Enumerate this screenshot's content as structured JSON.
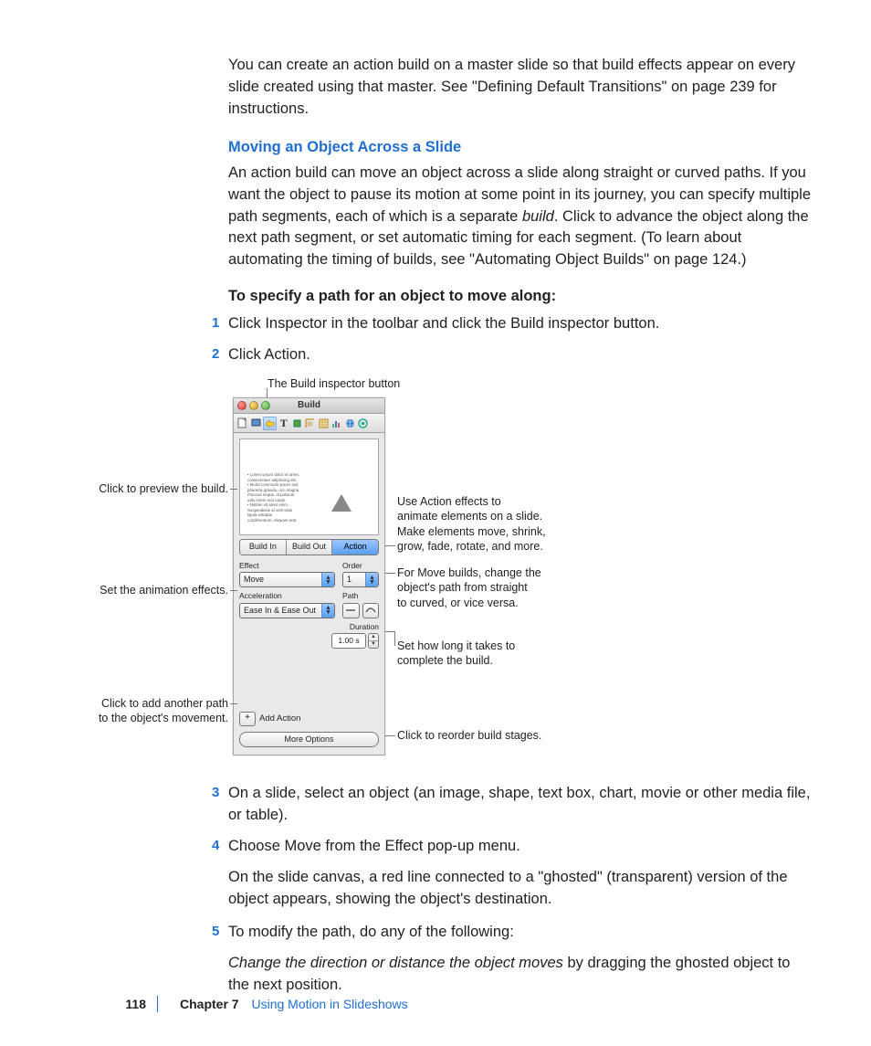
{
  "intro": "You can create an action build on a master slide so that build effects appear on every slide created using that master. See \"Defining Default Transitions\" on page 239 for instructions.",
  "section_heading": "Moving an Object Across a Slide",
  "section_body": "An action build can move an object across a slide along straight or curved paths. If you want the object to pause its motion at some point in its journey, you can specify multiple path segments, each of which is a separate build. Click to advance the object along the next path segment, or set automatic timing for each segment. (To learn about automating the timing of builds, see \"Automating Object Builds\" on page 124.)",
  "task_lead": "To specify a path for an object to move along:",
  "steps": {
    "s1": "Click Inspector in the toolbar and click the Build inspector button.",
    "s2": "Click Action.",
    "s3": "On a slide, select an object (an image, shape, text box, chart, movie or other media file, or table).",
    "s4": "Choose Move from the Effect pop-up menu.",
    "s4b": "On the slide canvas, a red line connected to a \"ghosted\" (transparent) version of the object appears, showing the object's destination.",
    "s5": "To modify the path, do any of the following:",
    "s5b_italic": "Change the direction or distance the object moves",
    "s5b_rest": " by dragging the ghosted object to the next position."
  },
  "figure": {
    "caption_top": "The Build inspector button",
    "callouts": {
      "preview": "Click to preview the build.",
      "effects": "Set the animation effects.",
      "addpath1": "Click to add another path",
      "addpath2": "to the object's movement.",
      "action1": "Use Action effects to",
      "action2": "animate elements on a slide.",
      "action3": "Make elements move, shrink,",
      "action4": "grow, fade, rotate, and more.",
      "path1": "For Move builds, change the",
      "path2": "object's path from straight",
      "path3": "to curved, or vice versa.",
      "dur1": "Set how long it takes to",
      "dur2": "complete the build.",
      "reorder": "Click to reorder build stages."
    }
  },
  "inspector": {
    "title": "Build",
    "tabs": {
      "in": "Build In",
      "out": "Build Out",
      "action": "Action"
    },
    "labels": {
      "effect": "Effect",
      "order": "Order",
      "accel": "Acceleration",
      "path": "Path",
      "duration": "Duration"
    },
    "values": {
      "effect": "Move",
      "order": "1",
      "accel": "Ease In & Ease Out",
      "duration": "1.00 s"
    },
    "add_action": "Add Action",
    "more_options": "More Options",
    "preview_bullets": "• Lorem ipsum dolor sit amet,\n  consectetuer adipiscing elit.\n• Morbi commodo ipsum sed\n  pharetra gravida, orci magna\n  rhoncus neque, id pulvinar\n  odio lorem non turpis.\n• Nullam sit amet enim.\n  Suspendisse id velit vitae\n  ligula volutpat\n  condimentum. Aliquam erat"
  },
  "footer": {
    "page": "118",
    "chapter_label": "Chapter 7",
    "chapter_name": "Using Motion in Slideshows"
  }
}
